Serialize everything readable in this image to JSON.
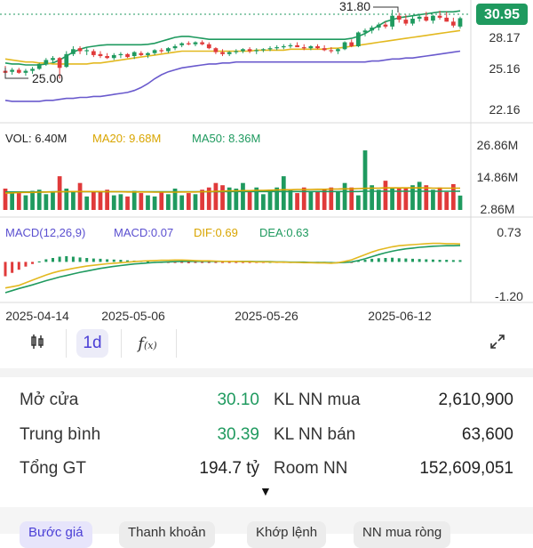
{
  "price_panel": {
    "current_price": "30.95",
    "high_marker": "31.80",
    "low_marker": "25.00",
    "axis_labels": [
      "28.17",
      "25.16",
      "22.16"
    ],
    "colors": {
      "up": "#1f9a5f",
      "down": "#e03a3a",
      "ma_upper": "#1f9a5f",
      "ma_mid": "#e3b920",
      "ma_lower": "#6a5acd"
    }
  },
  "volume_panel": {
    "vol_label": "VOL: 6.40M",
    "ma20_label": "MA20: 9.68M",
    "ma50_label": "MA50: 8.36M",
    "axis_labels": [
      "26.86M",
      "14.86M",
      "2.86M"
    ]
  },
  "macd_panel": {
    "title": "MACD(12,26,9)",
    "macd_label": "MACD:0.07",
    "dif_label": "DIF:0.69",
    "dea_label": "DEA:0.63",
    "axis_labels": [
      "0.73",
      "-1.20"
    ]
  },
  "date_labels": [
    "2025-04-14",
    "2025-05-06",
    "2025-05-26",
    "2025-06-12"
  ],
  "toolbar": {
    "candle_icon": "candlestick-icon",
    "interval_label": "1d",
    "indicator_icon": "function-icon",
    "expand_icon": "expand-icon"
  },
  "stats": {
    "open_label": "Mở cửa",
    "open_value": "30.10",
    "avg_label": "Trung bình",
    "avg_value": "30.39",
    "total_label": "Tổng GT",
    "total_value": "194.7 tỷ",
    "buy_label": "KL NN mua",
    "buy_value": "2,610,900",
    "sell_label": "KL NN bán",
    "sell_value": "63,600",
    "room_label": "Room NN",
    "room_value": "152,609,051",
    "more_icon": "caret-down-icon"
  },
  "tabs": [
    "Bước giá",
    "Thanh khoản",
    "Khớp lệnh",
    "NN mua ròng"
  ],
  "chart_data": {
    "type": "candlestick",
    "price_ylim": [
      20.5,
      32.8
    ],
    "ohlc": [
      [
        25.6,
        26.1,
        25.0,
        25.4
      ],
      [
        25.5,
        25.9,
        25.2,
        25.7
      ],
      [
        25.7,
        25.9,
        25.3,
        25.4
      ],
      [
        25.4,
        25.8,
        25.1,
        25.6
      ],
      [
        25.6,
        26.0,
        25.3,
        25.8
      ],
      [
        25.8,
        26.4,
        25.7,
        26.3
      ],
      [
        26.3,
        26.9,
        26.1,
        26.7
      ],
      [
        26.7,
        27.1,
        26.4,
        26.9
      ],
      [
        26.9,
        27.0,
        24.8,
        25.9
      ],
      [
        26.0,
        27.6,
        25.9,
        27.3
      ],
      [
        27.3,
        28.1,
        27.1,
        27.8
      ],
      [
        27.9,
        28.1,
        27.3,
        27.6
      ],
      [
        27.6,
        28.0,
        27.2,
        27.7
      ],
      [
        27.6,
        27.8,
        27.0,
        27.2
      ],
      [
        27.3,
        27.6,
        26.9,
        27.1
      ],
      [
        27.1,
        27.4,
        26.8,
        26.9
      ],
      [
        26.9,
        27.4,
        26.7,
        27.2
      ],
      [
        27.2,
        27.5,
        26.9,
        27.3
      ],
      [
        27.3,
        27.4,
        26.9,
        27.0
      ],
      [
        27.1,
        27.6,
        26.8,
        27.5
      ],
      [
        27.4,
        27.6,
        27.1,
        27.2
      ],
      [
        27.2,
        27.5,
        26.9,
        27.4
      ],
      [
        27.4,
        27.8,
        27.2,
        27.7
      ],
      [
        27.7,
        27.9,
        27.4,
        27.6
      ],
      [
        27.6,
        28.0,
        27.4,
        27.9
      ],
      [
        27.9,
        28.3,
        27.7,
        28.1
      ],
      [
        28.2,
        28.5,
        28.0,
        28.4
      ],
      [
        28.4,
        28.6,
        28.2,
        28.3
      ],
      [
        28.3,
        28.6,
        28.1,
        28.5
      ],
      [
        28.5,
        28.7,
        28.2,
        28.3
      ],
      [
        28.3,
        28.5,
        27.8,
        27.9
      ],
      [
        27.9,
        28.0,
        27.3,
        27.5
      ],
      [
        27.5,
        27.8,
        27.1,
        27.3
      ],
      [
        27.3,
        27.6,
        27.1,
        27.5
      ],
      [
        27.5,
        27.8,
        27.3,
        27.6
      ],
      [
        27.6,
        27.9,
        27.4,
        27.8
      ],
      [
        27.8,
        28.0,
        27.4,
        27.6
      ],
      [
        27.6,
        27.9,
        27.3,
        27.7
      ],
      [
        27.7,
        27.9,
        27.5,
        27.8
      ],
      [
        27.8,
        28.1,
        27.6,
        27.9
      ],
      [
        27.9,
        28.2,
        27.7,
        28.0
      ],
      [
        28.0,
        28.3,
        27.8,
        28.1
      ],
      [
        28.1,
        28.4,
        27.9,
        28.2
      ],
      [
        28.2,
        28.5,
        28.0,
        28.0
      ],
      [
        28.0,
        28.3,
        27.7,
        27.9
      ],
      [
        27.9,
        28.2,
        27.7,
        28.1
      ],
      [
        28.1,
        28.3,
        27.8,
        27.9
      ],
      [
        27.9,
        28.2,
        27.6,
        27.7
      ],
      [
        27.7,
        28.0,
        27.4,
        27.6
      ],
      [
        27.6,
        27.9,
        27.3,
        27.8
      ],
      [
        27.8,
        28.6,
        27.7,
        28.5
      ],
      [
        28.5,
        28.8,
        28.0,
        28.1
      ],
      [
        28.1,
        29.6,
        28.0,
        29.5
      ],
      [
        29.5,
        29.9,
        29.1,
        29.7
      ],
      [
        29.7,
        30.2,
        29.4,
        30.0
      ],
      [
        30.0,
        30.5,
        29.7,
        30.3
      ],
      [
        30.3,
        30.6,
        29.9,
        30.1
      ],
      [
        30.1,
        31.8,
        29.8,
        31.2
      ],
      [
        31.2,
        31.5,
        30.5,
        30.8
      ],
      [
        30.8,
        31.3,
        30.2,
        30.4
      ],
      [
        30.4,
        31.2,
        30.2,
        30.9
      ],
      [
        30.9,
        31.4,
        30.6,
        31.1
      ],
      [
        31.1,
        31.6,
        30.6,
        30.7
      ],
      [
        30.7,
        31.3,
        30.4,
        31.2
      ],
      [
        31.2,
        31.7,
        30.8,
        31.0
      ],
      [
        31.0,
        31.6,
        30.6,
        30.6
      ],
      [
        30.6,
        31.0,
        30.0,
        30.2
      ],
      [
        30.1,
        31.1,
        29.9,
        30.95
      ]
    ],
    "ma_upper": [
      26.4,
      26.3,
      26.3,
      26.2,
      26.2,
      26.2,
      26.3,
      26.4,
      26.7,
      27.1,
      27.5,
      27.8,
      28.0,
      28.1,
      28.2,
      28.25,
      28.25,
      28.25,
      28.25,
      28.25,
      28.25,
      28.3,
      28.4,
      28.6,
      28.8,
      29.0,
      29.1,
      29.1,
      29.0,
      28.9,
      28.8,
      28.8,
      28.8,
      28.8,
      28.8,
      28.8,
      28.8,
      28.8,
      28.8,
      28.8,
      28.8,
      28.8,
      28.8,
      28.8,
      28.8,
      28.8,
      28.8,
      28.8,
      28.8,
      28.8,
      28.8,
      28.9,
      29.1,
      29.4,
      29.8,
      30.2,
      30.6,
      30.8,
      31.0,
      31.1,
      31.2,
      31.3,
      31.4,
      31.5,
      31.6,
      31.6,
      31.6,
      31.7
    ],
    "ma_mid": [
      26.8,
      26.7,
      26.6,
      26.5,
      26.5,
      26.4,
      26.4,
      26.3,
      26.3,
      26.3,
      26.3,
      26.3,
      26.3,
      26.4,
      26.4,
      26.5,
      26.6,
      26.7,
      26.8,
      26.9,
      27.0,
      27.1,
      27.2,
      27.3,
      27.4,
      27.5,
      27.6,
      27.6,
      27.6,
      27.6,
      27.6,
      27.6,
      27.6,
      27.6,
      27.6,
      27.6,
      27.6,
      27.7,
      27.7,
      27.7,
      27.7,
      27.7,
      27.8,
      27.8,
      27.8,
      27.8,
      27.8,
      27.8,
      27.9,
      27.9,
      28.0,
      28.1,
      28.2,
      28.3,
      28.4,
      28.5,
      28.6,
      28.7,
      28.8,
      28.9,
      29.0,
      29.1,
      29.2,
      29.3,
      29.4,
      29.5,
      29.6,
      29.7
    ],
    "ma_lower": [
      22.6,
      22.5,
      22.5,
      22.5,
      22.5,
      22.5,
      22.6,
      22.6,
      22.7,
      22.8,
      22.8,
      22.9,
      22.9,
      23.0,
      23.0,
      23.1,
      23.2,
      23.3,
      23.4,
      23.6,
      23.9,
      24.3,
      24.8,
      25.2,
      25.5,
      25.7,
      25.9,
      26.0,
      26.1,
      26.2,
      26.3,
      26.3,
      26.4,
      26.4,
      26.5,
      26.5,
      26.5,
      26.5,
      26.5,
      26.5,
      26.5,
      26.5,
      26.5,
      26.5,
      26.5,
      26.5,
      26.5,
      26.5,
      26.5,
      26.5,
      26.5,
      26.5,
      26.5,
      26.5,
      26.6,
      26.6,
      26.7,
      26.8,
      26.8,
      26.9,
      26.9,
      27.0,
      27.1,
      27.2,
      27.3,
      27.4,
      27.5,
      27.6
    ],
    "volume_ylim": [
      0,
      28.5
    ],
    "volume": [
      9.5,
      8.0,
      7.5,
      6.5,
      8.5,
      9.0,
      7.0,
      8.0,
      15.0,
      9.5,
      8.0,
      12.0,
      6.0,
      8.5,
      8.0,
      9.0,
      6.5,
      7.0,
      6.0,
      8.5,
      7.5,
      6.5,
      6.0,
      8.0,
      7.0,
      9.5,
      6.5,
      7.5,
      7.0,
      9.0,
      10.0,
      12.0,
      11.0,
      10.0,
      9.5,
      12.0,
      8.5,
      10.0,
      7.0,
      9.0,
      10.0,
      15.0,
      9.0,
      7.5,
      10.0,
      8.0,
      8.5,
      9.0,
      10.0,
      8.0,
      12.0,
      10.0,
      6.5,
      26.5,
      11.0,
      9.0,
      13.0,
      10.0,
      9.5,
      10.0,
      11.0,
      12.5,
      11.0,
      9.0,
      10.0,
      8.0,
      11.5,
      6.4
    ],
    "vol_ma20": [
      7.5,
      7.6,
      7.7,
      7.8,
      7.8,
      7.9,
      8.0,
      8.0,
      8.1,
      8.1,
      8.2,
      8.2,
      8.2,
      8.2,
      8.2,
      8.1,
      8.1,
      8.1,
      8.0,
      8.0,
      8.0,
      8.0,
      7.9,
      7.9,
      7.9,
      7.9,
      8.0,
      8.0,
      8.0,
      8.1,
      8.2,
      8.3,
      8.4,
      8.5,
      8.5,
      8.6,
      8.6,
      8.7,
      8.7,
      8.8,
      8.9,
      9.0,
      9.0,
      9.1,
      9.1,
      9.1,
      9.2,
      9.2,
      9.3,
      9.3,
      9.4,
      9.4,
      9.5,
      9.6,
      9.7,
      9.7,
      9.8,
      9.8,
      9.8,
      9.8,
      9.8,
      9.8,
      9.8,
      9.7,
      9.7,
      9.7,
      9.7,
      9.68
    ],
    "vol_ma50": [
      8.0,
      8.0,
      8.0,
      8.0,
      8.0,
      8.0,
      8.0,
      8.1,
      8.1,
      8.1,
      8.1,
      8.1,
      8.1,
      8.1,
      8.1,
      8.1,
      8.1,
      8.1,
      8.1,
      8.1,
      8.1,
      8.1,
      8.1,
      8.1,
      8.1,
      8.1,
      8.1,
      8.1,
      8.1,
      8.1,
      8.1,
      8.1,
      8.1,
      8.2,
      8.2,
      8.2,
      8.2,
      8.2,
      8.2,
      8.2,
      8.2,
      8.2,
      8.2,
      8.2,
      8.2,
      8.2,
      8.2,
      8.2,
      8.2,
      8.2,
      8.2,
      8.2,
      8.2,
      8.3,
      8.3,
      8.3,
      8.3,
      8.3,
      8.3,
      8.3,
      8.3,
      8.3,
      8.3,
      8.3,
      8.3,
      8.3,
      8.3,
      8.36
    ],
    "macd_ylim": [
      -1.35,
      0.9
    ],
    "macd_hist": [
      -0.55,
      -0.42,
      -0.3,
      -0.18,
      -0.08,
      0.02,
      0.1,
      0.15,
      0.2,
      0.22,
      0.2,
      0.17,
      0.15,
      0.13,
      0.12,
      0.1,
      0.09,
      0.08,
      0.06,
      0.05,
      0.04,
      0.02,
      0.0,
      -0.02,
      -0.02,
      -0.04,
      -0.04,
      -0.05,
      -0.04,
      -0.03,
      -0.02,
      -0.02,
      -0.03,
      -0.02,
      -0.02,
      -0.03,
      -0.02,
      -0.01,
      -0.01,
      0.0,
      -0.02,
      -0.01,
      -0.02,
      -0.02,
      -0.03,
      -0.04,
      -0.04,
      -0.05,
      -0.05,
      -0.04,
      -0.03,
      -0.02,
      0.04,
      0.08,
      0.12,
      0.14,
      0.15,
      0.16,
      0.14,
      0.13,
      0.12,
      0.11,
      0.1,
      0.09,
      0.08,
      0.08,
      0.07,
      0.07
    ],
    "dif": [
      -1.0,
      -0.95,
      -0.9,
      -0.8,
      -0.7,
      -0.6,
      -0.5,
      -0.42,
      -0.35,
      -0.3,
      -0.25,
      -0.2,
      -0.16,
      -0.13,
      -0.1,
      -0.07,
      -0.05,
      -0.03,
      -0.01,
      0.01,
      0.03,
      0.04,
      0.05,
      0.06,
      0.06,
      0.07,
      0.07,
      0.06,
      0.05,
      0.04,
      0.04,
      0.03,
      0.02,
      0.02,
      0.02,
      0.01,
      0.01,
      0.0,
      0.0,
      0.0,
      -0.01,
      -0.01,
      -0.02,
      -0.02,
      -0.03,
      -0.03,
      -0.04,
      -0.04,
      -0.05,
      -0.03,
      0.02,
      0.08,
      0.18,
      0.28,
      0.38,
      0.46,
      0.52,
      0.58,
      0.62,
      0.64,
      0.66,
      0.68,
      0.7,
      0.71,
      0.71,
      0.7,
      0.7,
      0.69
    ],
    "dea": [
      -1.18,
      -1.1,
      -1.02,
      -0.95,
      -0.88,
      -0.8,
      -0.72,
      -0.65,
      -0.58,
      -0.52,
      -0.46,
      -0.4,
      -0.35,
      -0.3,
      -0.25,
      -0.21,
      -0.17,
      -0.14,
      -0.11,
      -0.08,
      -0.06,
      -0.04,
      -0.02,
      -0.01,
      0.0,
      0.01,
      0.02,
      0.02,
      0.02,
      0.02,
      0.02,
      0.02,
      0.02,
      0.02,
      0.02,
      0.02,
      0.02,
      0.01,
      0.01,
      0.01,
      0.0,
      0.0,
      -0.01,
      -0.01,
      -0.01,
      -0.02,
      -0.02,
      -0.02,
      -0.03,
      -0.03,
      -0.02,
      0.0,
      0.05,
      0.12,
      0.2,
      0.28,
      0.35,
      0.41,
      0.46,
      0.5,
      0.53,
      0.56,
      0.58,
      0.6,
      0.61,
      0.62,
      0.62,
      0.63
    ],
    "x_labels": [
      "2025-04-14",
      "2025-05-06",
      "2025-05-26",
      "2025-06-12"
    ]
  }
}
